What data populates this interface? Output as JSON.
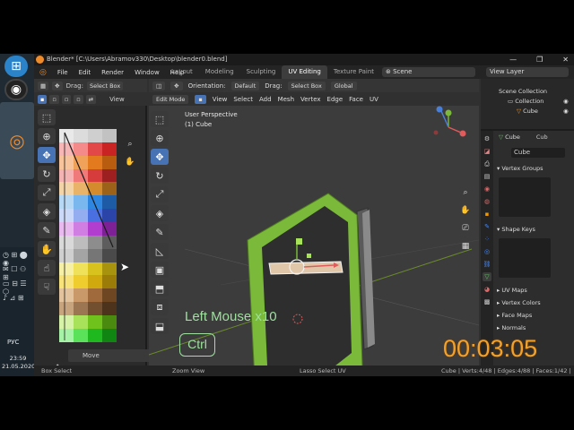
{
  "taskbar": {
    "tray_rows": [
      "◷ ⊞ ⬤ ◉",
      "✉ ☐ ⚇ ⊞",
      "▭ ⊟ ☰ ⬡",
      "♪ ⊿ ⊞"
    ],
    "language": "РУС",
    "time": "23:59",
    "date": "21.05.2020"
  },
  "window": {
    "title": "Blender* [C:\\Users\\Abramov330\\Desktop\\blender0.blend]",
    "buttons": [
      "—",
      "❐",
      "✕"
    ]
  },
  "menu": {
    "items": [
      "File",
      "Edit",
      "Render",
      "Window",
      "Help"
    ],
    "workspaces": [
      "Layout",
      "Modeling",
      "Sculpting",
      "UV Editing",
      "Texture Paint",
      "Sh"
    ],
    "active_workspace": "UV Editing",
    "scene": "Scene",
    "view_layer": "View Layer"
  },
  "uv_editor": {
    "drag_label": "Drag:",
    "drag_value": "Select Box",
    "view_label": "View",
    "move_label": "Move",
    "palette": [
      [
        "#e9e9e9",
        "#dcdcdc",
        "#cfcfcf",
        "#c2c2c2"
      ],
      [
        "#f6b6b6",
        "#f48a8a",
        "#e24848",
        "#c92323"
      ],
      [
        "#f7c39a",
        "#f1a25a",
        "#e37a1e",
        "#b85c10"
      ],
      [
        "#f4b3b3",
        "#f07a7a",
        "#d63c3c",
        "#9e1f1f"
      ],
      [
        "#f3d3a8",
        "#e9b36a",
        "#d48b2d",
        "#9c621a"
      ],
      [
        "#b7d8f5",
        "#7ab7ef",
        "#2f86e1",
        "#1d5ba6"
      ],
      [
        "#ccd8f7",
        "#93adf0",
        "#4a6fe0",
        "#2b44a8"
      ],
      [
        "#e7b9ef",
        "#d17ee3",
        "#b23ecf",
        "#7e2096"
      ],
      [
        "#d9d9d9",
        "#bdbdbd",
        "#8d8d8d",
        "#5d5d5d"
      ],
      [
        "#cfcfcf",
        "#a4a4a4",
        "#767676",
        "#4a4a4a"
      ],
      [
        "#f6f0a6",
        "#efe15a",
        "#d8c21d",
        "#a8930f"
      ],
      [
        "#f8e27a",
        "#f0cd2e",
        "#d0a90e",
        "#9b7c08"
      ],
      [
        "#e3c39e",
        "#c9996a",
        "#a06a3c",
        "#6e4622"
      ],
      [
        "#c8a47e",
        "#9c7652",
        "#72502f",
        "#4d331c"
      ],
      [
        "#d6f2a8",
        "#a8e25b",
        "#6fc21c",
        "#4a8a0f"
      ],
      [
        "#a6f2a6",
        "#5ae25a",
        "#1fb81f",
        "#118511"
      ]
    ]
  },
  "viewport": {
    "mode": "Edit Mode",
    "orientation_label": "Orientation:",
    "orientation_value": "Default",
    "drag_label": "Drag:",
    "drag_value": "Select Box",
    "transform_label": "Global",
    "menus": [
      "View",
      "Select",
      "Add",
      "Mesh",
      "Vertex",
      "Edge",
      "Face",
      "UV"
    ],
    "info_line1": "User Perspective",
    "info_line2": "(1) Cube",
    "overlay_text": "Left Mouse x10",
    "key": "Ctrl"
  },
  "outliner": {
    "title": "Scene Collection",
    "collection": "Collection",
    "object": "Cube"
  },
  "properties": {
    "object_name": "Cube",
    "object_name_2": "Cub",
    "mesh_field": "Cube",
    "sections": [
      "Vertex Groups",
      "Shape Keys",
      "UV Maps",
      "Vertex Colors",
      "Face Maps",
      "Normals"
    ]
  },
  "statusbar": {
    "left": "Box Select",
    "mid": "Zoom View",
    "mid2": "Lasso Select UV",
    "right": "Cube | Verts:4/48 | Edges:4/88 | Faces:1/42 | Triss"
  },
  "timer": "00:03:05",
  "colors": {
    "accent": "#4772b3",
    "object_green": "#7ab93a",
    "timer": "#f2a22a",
    "overlay": "#9fe09f"
  }
}
